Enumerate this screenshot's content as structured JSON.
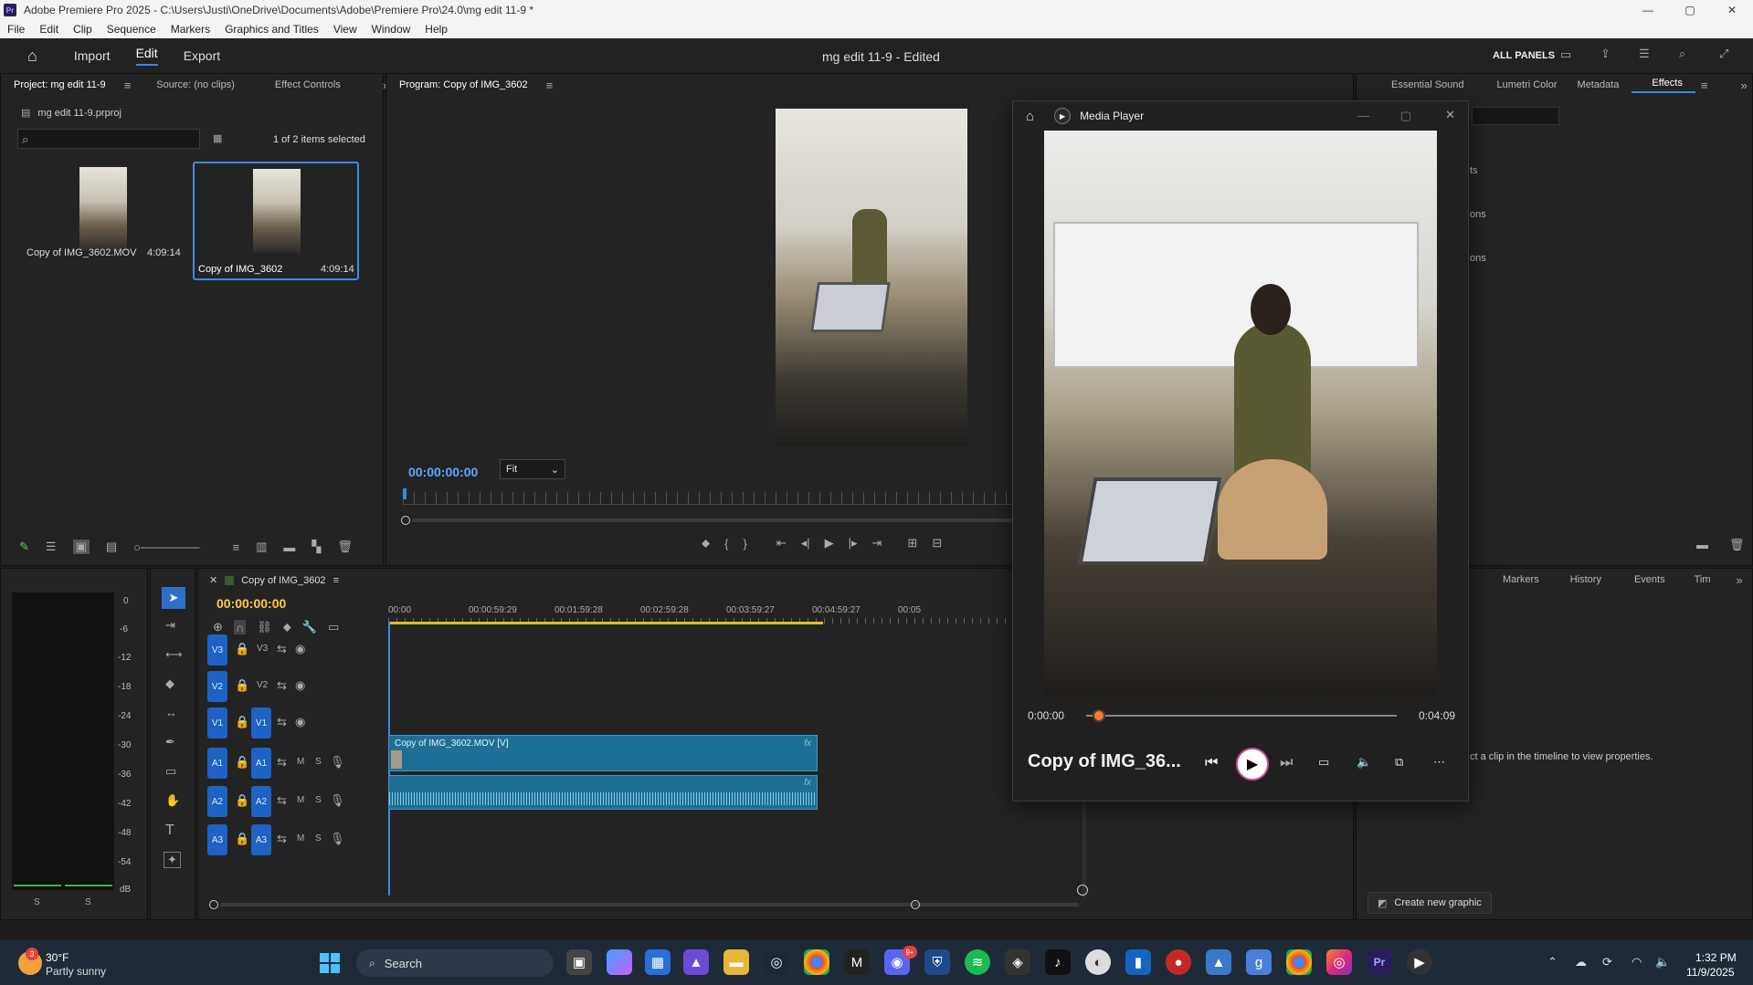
{
  "window": {
    "title": "Adobe Premiere Pro 2025 - C:\\Users\\Justi\\OneDrive\\Documents\\Adobe\\Premiere Pro\\24.0\\mg edit 11-9 *",
    "app_badge": "Pr"
  },
  "menu": [
    "File",
    "Edit",
    "Clip",
    "Sequence",
    "Markers",
    "Graphics and Titles",
    "View",
    "Window",
    "Help"
  ],
  "header": {
    "tabs": [
      "Import",
      "Edit",
      "Export"
    ],
    "active": "Edit",
    "doc_title": "mg edit 11-9 - Edited",
    "all_panels": "ALL PANELS"
  },
  "project": {
    "tabs": [
      "Project: mg edit 11-9",
      "Source: (no clips)",
      "Effect Controls"
    ],
    "file": "mg edit 11-9.prproj",
    "selection": "1 of 2 items selected",
    "items": [
      {
        "name": "Copy of IMG_3602.MOV",
        "duration": "4:09:14"
      },
      {
        "name": "Copy of IMG_3602",
        "duration": "4:09:14"
      }
    ]
  },
  "program": {
    "tab": "Program: Copy of IMG_3602",
    "timecode": "00:00:00:00",
    "fit": "Fit"
  },
  "right_panel": {
    "tabs": [
      "Essential Sound",
      "Lumetri Color",
      "Metadata",
      "Effects"
    ],
    "active": "Effects",
    "partial_items": [
      "ts",
      "ons",
      "ons"
    ],
    "lower_tabs": [
      "Markers",
      "History",
      "Events",
      "Tim"
    ],
    "props_hint": "ct a clip in the timeline to view properties.",
    "create_graphic": "Create new graphic"
  },
  "meter": {
    "scale": [
      "0",
      "-6",
      "-12",
      "-18",
      "-24",
      "-30",
      "-36",
      "-42",
      "-48",
      "-54",
      "dB"
    ],
    "solo": [
      "S",
      "S"
    ]
  },
  "timeline": {
    "tab": "Copy of IMG_3602",
    "timecode": "00:00:00:00",
    "ruler": [
      "00:00",
      "00:00:59:29",
      "00:01:59:28",
      "00:02:59:28",
      "00:03:59:27",
      "00:04:59:27",
      "00:05"
    ],
    "video_clip": "Copy of IMG_3602.MOV [V]",
    "fx": "fx",
    "video_tracks": [
      {
        "src": "V3",
        "name": "V3"
      },
      {
        "src": "V2",
        "name": "V2"
      },
      {
        "src": "V1",
        "name": "V1"
      }
    ],
    "audio_tracks": [
      {
        "src": "A1",
        "name": "A1",
        "m": "M",
        "s": "S"
      },
      {
        "src": "A2",
        "name": "A2",
        "m": "M",
        "s": "S"
      },
      {
        "src": "A3",
        "name": "A3",
        "m": "M",
        "s": "S"
      }
    ]
  },
  "media_player": {
    "title": "Media Player",
    "time_start": "0:00:00",
    "time_end": "0:04:09",
    "clip_name": "Copy of IMG_36...",
    "progress": 0.02
  },
  "taskbar": {
    "weather_temp": "30°F",
    "weather_desc": "Partly sunny",
    "search": "Search",
    "time": "1:32 PM",
    "date": "11/9/2025",
    "weather_badge": "3",
    "discord_badge": "9+"
  },
  "colors": {
    "accent": "#2d8ceb",
    "track": "#1d62c4",
    "clip": "#1e6f95",
    "orange": "#ff7a2e"
  }
}
